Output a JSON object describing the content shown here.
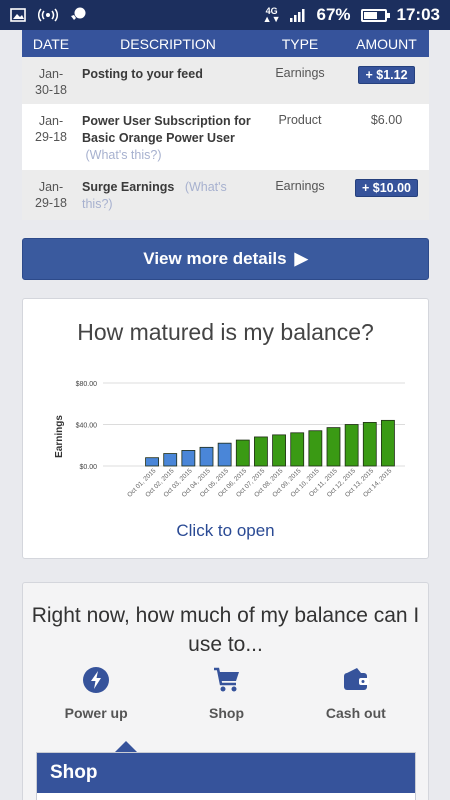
{
  "status": {
    "network": "4G",
    "battery": "67%",
    "time": "17:03"
  },
  "table": {
    "headers": [
      "DATE",
      "DESCRIPTION",
      "TYPE",
      "AMOUNT"
    ],
    "rows": [
      {
        "date_l1": "Jan-",
        "date_l2": "30-18",
        "desc": "Posting to your feed",
        "whats": "",
        "type": "Earnings",
        "amount": "$1.12",
        "badge": true
      },
      {
        "date_l1": "Jan-",
        "date_l2": "29-18",
        "desc": "Power User Subscription for Basic Orange Power User",
        "whats": "(What's this?)",
        "type": "Product",
        "amount": "$6.00",
        "badge": false
      },
      {
        "date_l1": "Jan-",
        "date_l2": "29-18",
        "desc": "Surge Earnings",
        "whats": "(What's this?)",
        "type": "Earnings",
        "amount": "$10.00",
        "badge": true
      }
    ]
  },
  "details_button": "View more details",
  "maturity": {
    "title": "How matured is my balance?",
    "link": "Click to open"
  },
  "chart_data": {
    "type": "bar",
    "title": "",
    "ylabel": "Earnings",
    "xlabel": "",
    "ylim": [
      0,
      80
    ],
    "yticks": [
      "$80.00",
      "$40.00",
      "$0.00"
    ],
    "categories": [
      "Oct 01, 2015",
      "Oct 02, 2015",
      "Oct 03, 2015",
      "Oct 04, 2015",
      "Oct 05, 2015",
      "Oct 06, 2015",
      "Oct 07, 2015",
      "Oct 08, 2015",
      "Oct 09, 2015",
      "Oct 10, 2015",
      "Oct 11, 2015",
      "Oct 12, 2015",
      "Oct 13, 2015",
      "Oct 14, 2015"
    ],
    "values": [
      8,
      12,
      15,
      18,
      22,
      25,
      28,
      30,
      32,
      34,
      37,
      40,
      42,
      44
    ],
    "colors": [
      "#4a86d8",
      "#4a86d8",
      "#4a86d8",
      "#4a86d8",
      "#4a86d8",
      "#3a9a14",
      "#3a9a14",
      "#3a9a14",
      "#3a9a14",
      "#3a9a14",
      "#3a9a14",
      "#3a9a14",
      "#3a9a14",
      "#3a9a14"
    ]
  },
  "use_balance": {
    "title": "Right now, how much of my balance can I use to...",
    "options": [
      {
        "label": "Power up",
        "icon": "bolt-icon"
      },
      {
        "label": "Shop",
        "icon": "cart-icon"
      },
      {
        "label": "Cash out",
        "icon": "wallet-icon"
      }
    ],
    "panel_title": "Shop"
  }
}
